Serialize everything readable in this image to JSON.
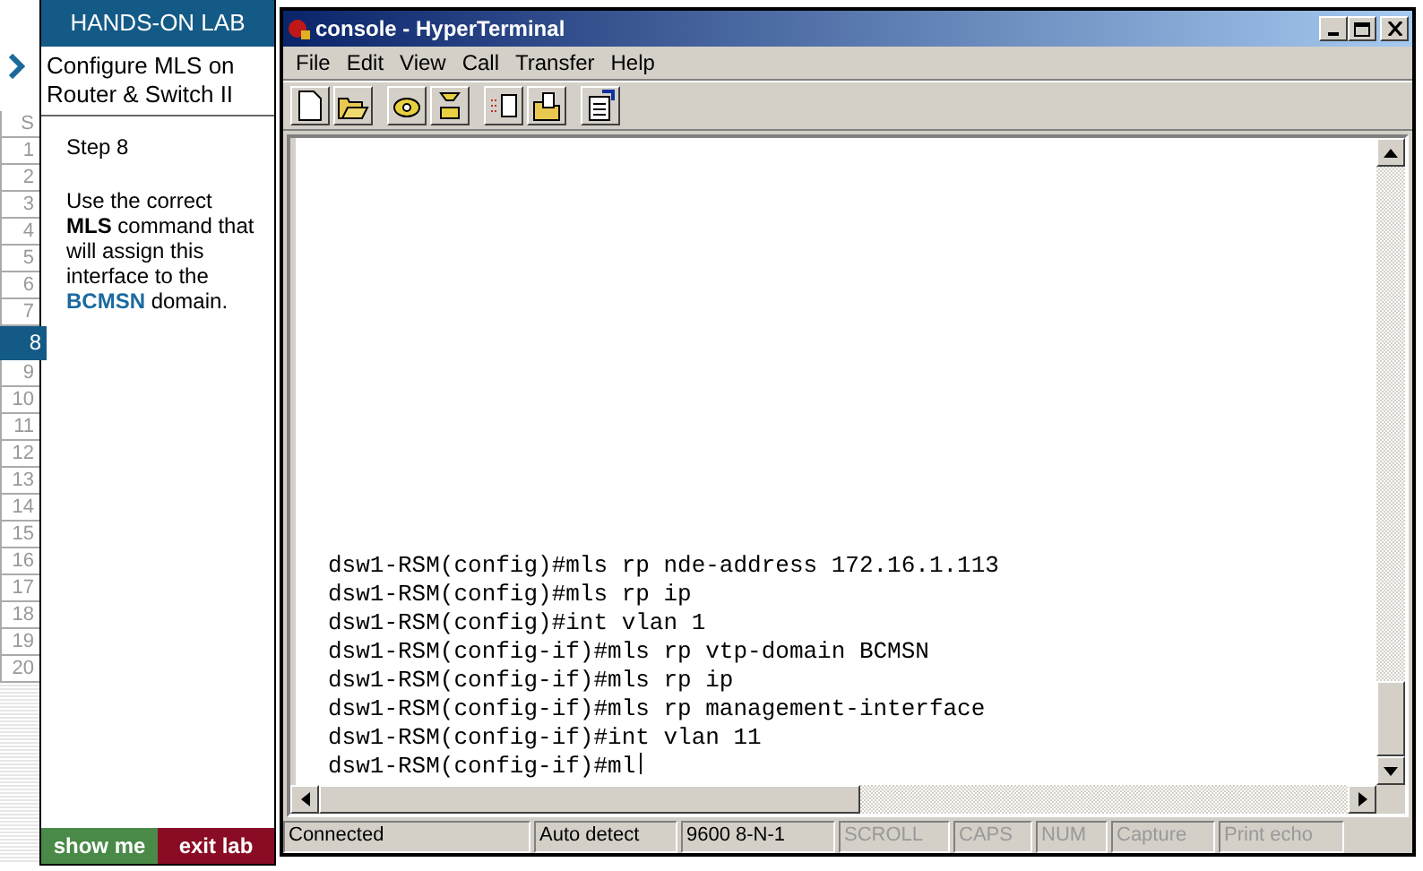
{
  "lab": {
    "header": "HANDS-ON LAB",
    "title": "Configure MLS on Router & Switch II",
    "step_label": "Step 8",
    "description": [
      {
        "text": "Use the correct ",
        "kind": "plain"
      },
      {
        "text": "MLS",
        "kind": "bold"
      },
      {
        "text": " command that will assign this interface to the ",
        "kind": "plain"
      },
      {
        "text": "BCMSN",
        "kind": "term"
      },
      {
        "text": " domain.",
        "kind": "plain"
      }
    ],
    "buttons": [
      {
        "label": "show me",
        "kind": "show"
      },
      {
        "label": "exit lab",
        "kind": "exit"
      }
    ]
  },
  "steps": [
    {
      "label": "S",
      "selected": false
    },
    {
      "label": "1",
      "selected": false
    },
    {
      "label": "2",
      "selected": false
    },
    {
      "label": "3",
      "selected": false
    },
    {
      "label": "4",
      "selected": false
    },
    {
      "label": "5",
      "selected": false
    },
    {
      "label": "6",
      "selected": false
    },
    {
      "label": "7",
      "selected": false
    },
    {
      "label": "8",
      "selected": true
    },
    {
      "label": "9",
      "selected": false
    },
    {
      "label": "10",
      "selected": false
    },
    {
      "label": "11",
      "selected": false
    },
    {
      "label": "12",
      "selected": false
    },
    {
      "label": "13",
      "selected": false
    },
    {
      "label": "14",
      "selected": false
    },
    {
      "label": "15",
      "selected": false
    },
    {
      "label": "16",
      "selected": false
    },
    {
      "label": "17",
      "selected": false
    },
    {
      "label": "18",
      "selected": false
    },
    {
      "label": "19",
      "selected": false
    },
    {
      "label": "20",
      "selected": false
    }
  ],
  "window": {
    "title": "console - HyperTerminal",
    "menu": [
      "File",
      "Edit",
      "View",
      "Call",
      "Transfer",
      "Help"
    ],
    "terminal": [
      "dsw1-RSM(config)#mls rp nde-address 172.16.1.113",
      "dsw1-RSM(config)#mls rp ip",
      "dsw1-RSM(config)#int vlan 1",
      "dsw1-RSM(config-if)#mls rp vtp-domain BCMSN",
      "dsw1-RSM(config-if)#mls rp ip",
      "dsw1-RSM(config-if)#mls rp management-interface",
      "dsw1-RSM(config-if)#int vlan 11",
      "dsw1-RSM(config-if)#ml"
    ],
    "status_bar": [
      {
        "text": "Connected",
        "disabled": false
      },
      {
        "text": "Auto detect",
        "disabled": false
      },
      {
        "text": "9600 8-N-1",
        "disabled": false
      },
      {
        "text": "SCROLL",
        "disabled": true
      },
      {
        "text": "CAPS",
        "disabled": true
      },
      {
        "text": "NUM",
        "disabled": true
      },
      {
        "text": "Capture",
        "disabled": true
      },
      {
        "text": "Print echo",
        "disabled": true
      }
    ]
  }
}
